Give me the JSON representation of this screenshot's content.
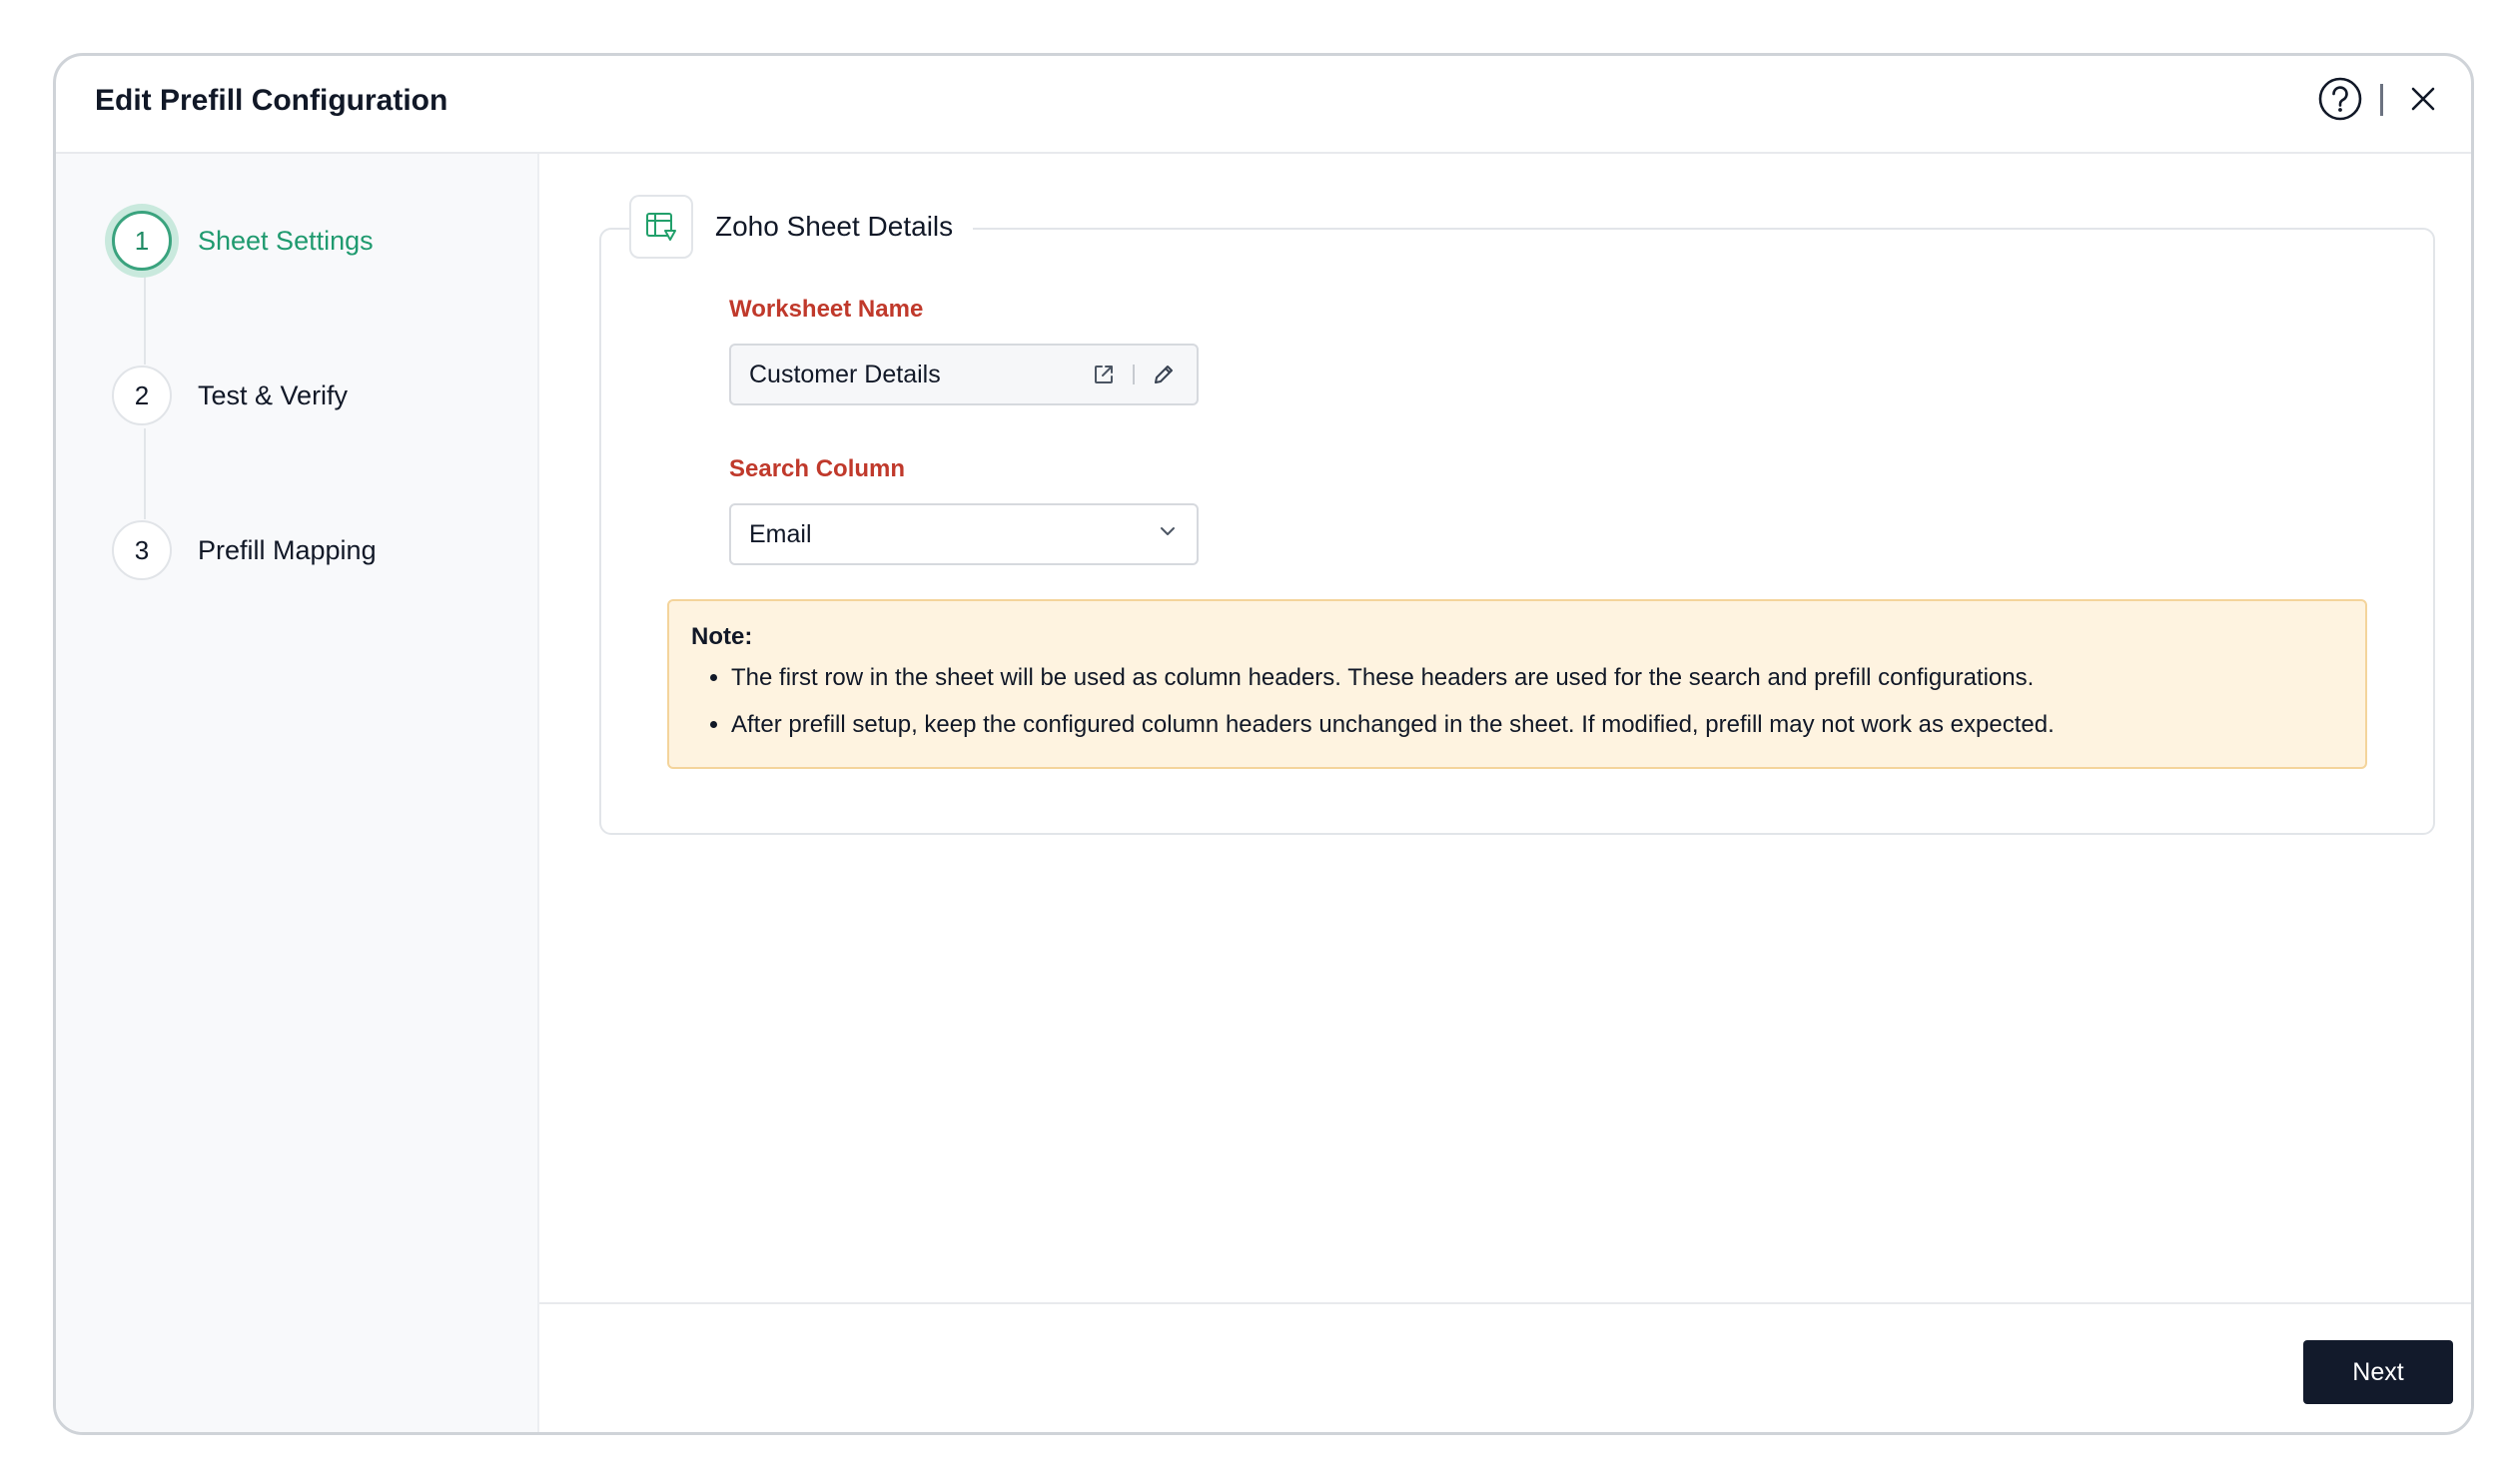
{
  "dialog": {
    "title": "Edit Prefill Configuration",
    "help_icon": "help-circle-icon",
    "close_icon": "close-icon"
  },
  "steps": [
    {
      "number": "1",
      "label": "Sheet Settings",
      "active": true
    },
    {
      "number": "2",
      "label": "Test & Verify",
      "active": false
    },
    {
      "number": "3",
      "label": "Prefill Mapping",
      "active": false
    }
  ],
  "section": {
    "title": "Zoho Sheet Details",
    "icon": "zoho-sheet-icon"
  },
  "worksheet": {
    "label": "Worksheet Name",
    "value": "Customer Details",
    "open_icon": "external-link-icon",
    "edit_icon": "pencil-icon"
  },
  "search_column": {
    "label": "Search Column",
    "value": "Email"
  },
  "note": {
    "title": "Note:",
    "items": [
      "The first row in the sheet will be used as column headers. These headers are used for the search and prefill configurations.",
      "After prefill setup, keep the configured column headers unchanged in the sheet. If modified, prefill may not work as expected."
    ]
  },
  "footer": {
    "next_label": "Next"
  },
  "colors": {
    "accent_green": "#1f9a6f",
    "label_red": "#c0392b",
    "note_bg": "#fef3e0",
    "button_dark": "#121a2b"
  }
}
